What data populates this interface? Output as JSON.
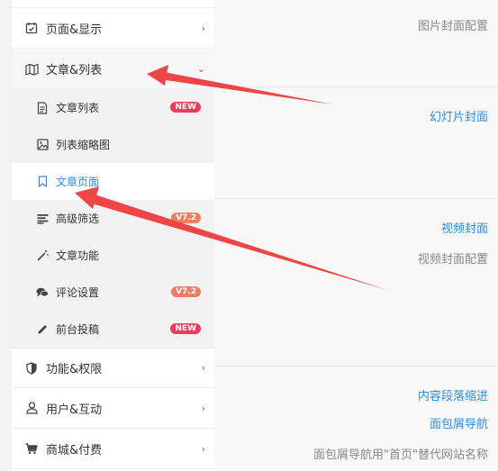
{
  "sidebar": {
    "items": [
      {
        "label": "页面&显示",
        "icon": "calendar-check-icon",
        "arrow": "›"
      },
      {
        "label": "文章&列表",
        "icon": "map-icon",
        "arrow": "⌄"
      },
      {
        "label": "功能&权限",
        "icon": "shield-icon",
        "arrow": "›"
      },
      {
        "label": "用户&互动",
        "icon": "user-icon",
        "arrow": "›"
      },
      {
        "label": "商城&付费",
        "icon": "cart-icon",
        "arrow": "›"
      }
    ],
    "subitems": [
      {
        "label": "文章列表",
        "icon": "document-icon",
        "badge": "NEW"
      },
      {
        "label": "列表缩略图",
        "icon": "image-icon"
      },
      {
        "label": "文章页面",
        "icon": "bookmark-icon"
      },
      {
        "label": "高级筛选",
        "icon": "filter-lines-icon",
        "badge": "V7.2"
      },
      {
        "label": "文章功能",
        "icon": "magic-wand-icon"
      },
      {
        "label": "评论设置",
        "icon": "comment-icon",
        "badge": "V7.2"
      },
      {
        "label": "前台投稿",
        "icon": "pencil-icon",
        "badge": "NEW"
      }
    ]
  },
  "main": {
    "texts": [
      "图片封面配置",
      "幻灯片封面",
      "视频封面",
      "视频封面配置",
      "内容段落缩进",
      "面包屑导航",
      "面包屑导航用\"首页\"替代网站名称"
    ]
  },
  "colors": {
    "accent": "#2b8be8",
    "new_badge": "#ef3b5a",
    "version_badge": "#f07d62",
    "arrow": "#ee4646"
  }
}
